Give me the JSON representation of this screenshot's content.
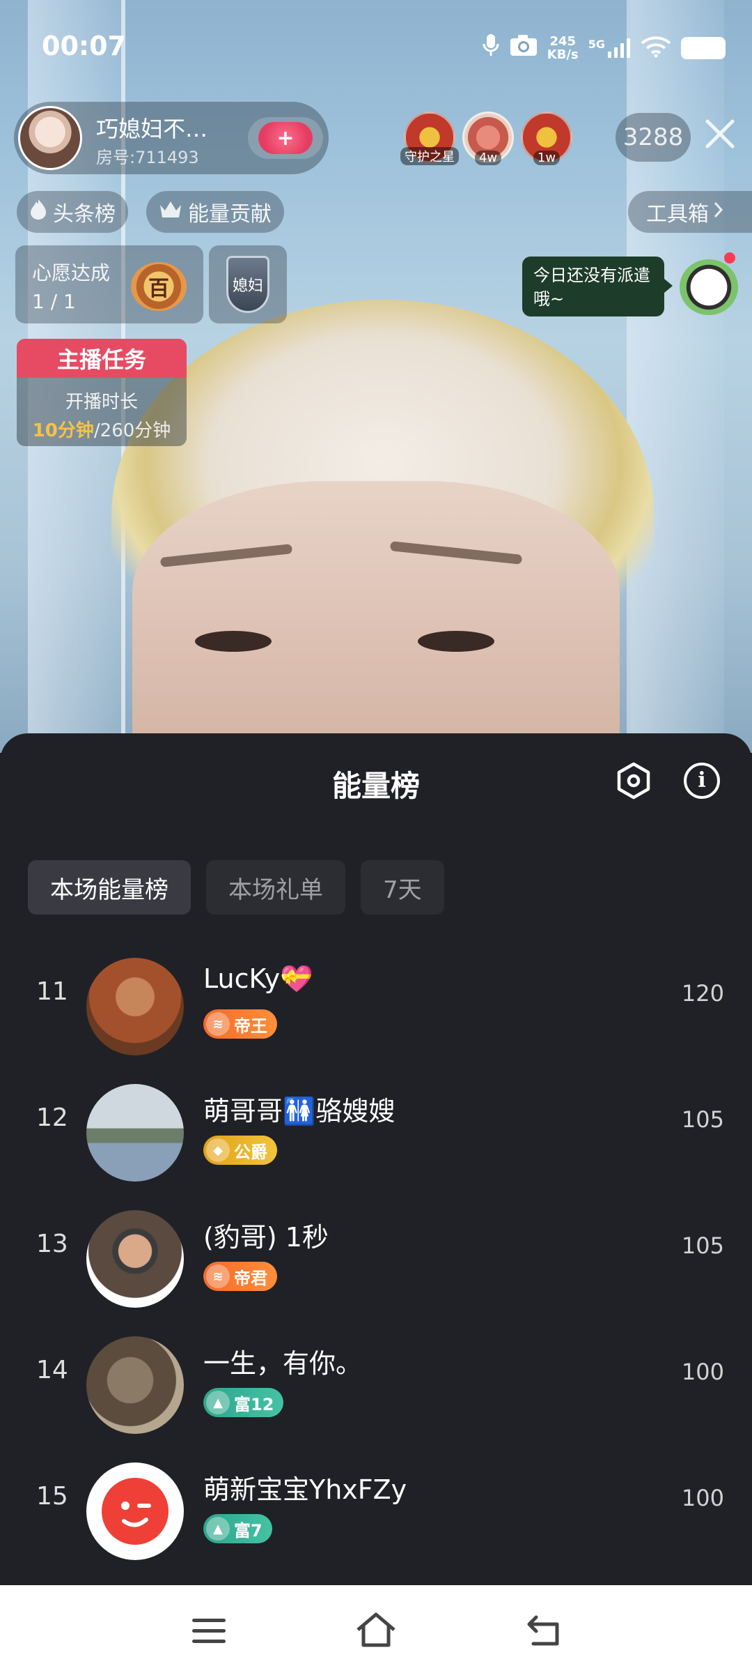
{
  "status_bar": {
    "time": "00:07",
    "net_speed_value": "245",
    "net_speed_unit": "KB/s",
    "network": "5G"
  },
  "streamer": {
    "name": "巧媳妇不…",
    "room": "房号:711493",
    "follow_label": "+"
  },
  "viewers": {
    "items": [
      {
        "tag": "守护之星"
      },
      {
        "tag": "4w"
      },
      {
        "tag": "1w"
      }
    ],
    "count": "3288"
  },
  "chips": {
    "headline": "头条榜",
    "energy": "能量贡献",
    "toolbox": "工具箱"
  },
  "wish": {
    "title": "心愿达成",
    "progress": "1 / 1",
    "medal": "百"
  },
  "badge": {
    "label": "媳妇"
  },
  "task": {
    "title": "主播任务",
    "line1": "开播时长",
    "done": "10分钟",
    "total": "/260分钟"
  },
  "bubble": {
    "text": "今日还没有派遣哦~"
  },
  "sheet": {
    "title": "能量榜",
    "tabs": [
      "本场能量榜",
      "本场礼单",
      "7天"
    ]
  },
  "ranking": [
    {
      "rank": "11",
      "name": "LucKy💝",
      "badge": "帝王",
      "badge_style": "orange",
      "score": "120"
    },
    {
      "rank": "12",
      "name": "萌哥哥🚻骆嫂嫂",
      "badge": "公爵",
      "badge_style": "gold",
      "score": "105"
    },
    {
      "rank": "13",
      "name": "(豹哥) 1秒",
      "badge": "帝君",
      "badge_style": "orange",
      "score": "105"
    },
    {
      "rank": "14",
      "name": "一生，有你。",
      "badge": "富12",
      "badge_style": "green",
      "score": "100"
    },
    {
      "rank": "15",
      "name": "萌新宝宝YhxFZy",
      "badge": "富7",
      "badge_style": "green",
      "score": "100"
    }
  ],
  "colors": {
    "sheet_bg": "#202126",
    "task_red": "#e64b63",
    "task_highlight": "#f5c343",
    "badge_orange": "#f46a2a",
    "badge_gold": "#e1a21a",
    "badge_green": "#2ea58c"
  }
}
